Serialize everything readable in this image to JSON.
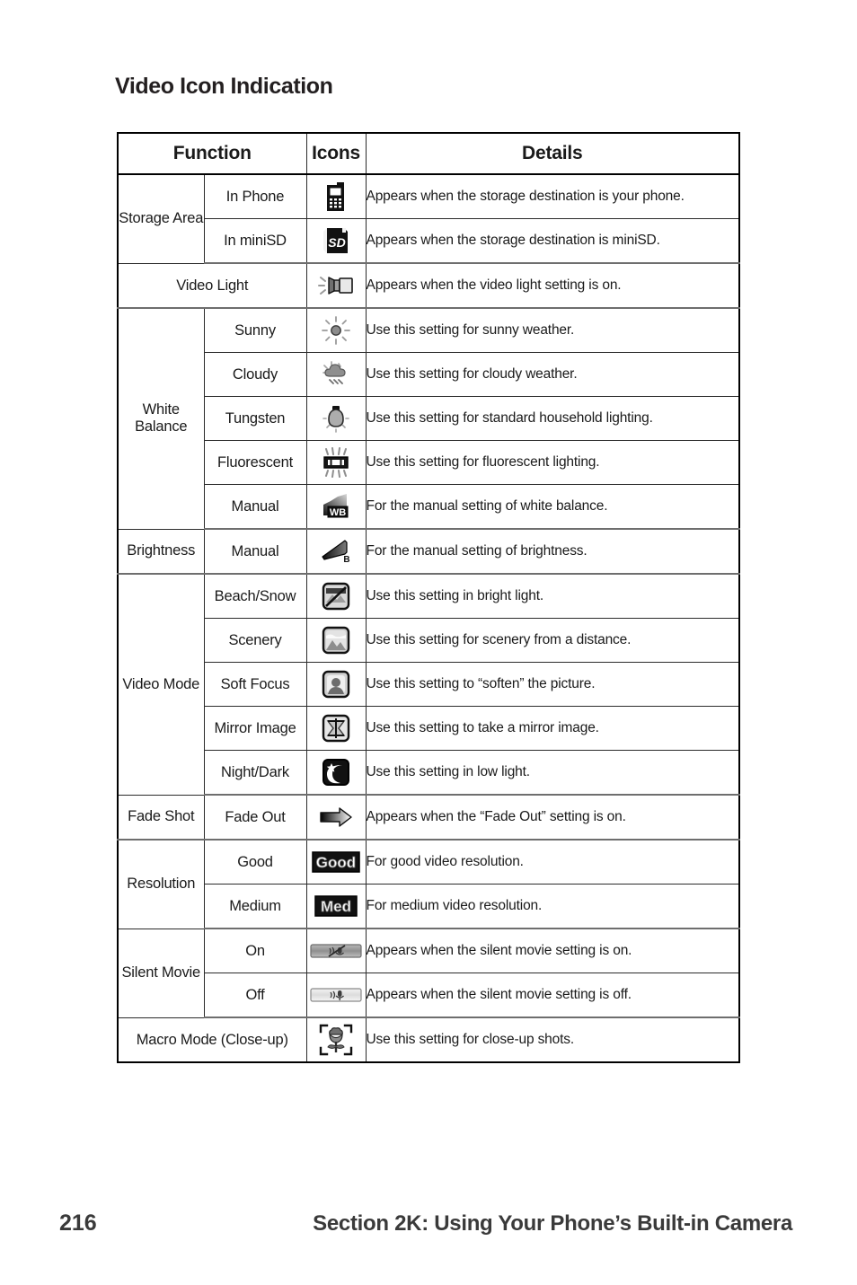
{
  "page": {
    "title": "Video Icon Indication",
    "footer_page_number": "216",
    "footer_section": "Section 2K: Using Your Phone’s Built-in Camera"
  },
  "table": {
    "headers": {
      "function": "Function",
      "icons": "Icons",
      "details": "Details"
    },
    "groups": [
      {
        "function": "Storage Area",
        "rows": [
          {
            "sub": "In Phone",
            "icon": "phone-icon",
            "detail": "Appears when the storage destination is your phone."
          },
          {
            "sub": "In miniSD",
            "icon": "minisd-card-icon",
            "detail": "Appears when the storage destination is miniSD."
          }
        ]
      },
      {
        "function": "Video Light",
        "full_span": true,
        "rows": [
          {
            "sub": "",
            "icon": "flashlight-icon",
            "detail": "Appears when the video light setting is on."
          }
        ]
      },
      {
        "function": "White Balance",
        "rows": [
          {
            "sub": "Sunny",
            "icon": "sun-icon",
            "detail": "Use this setting for sunny weather."
          },
          {
            "sub": "Cloudy",
            "icon": "cloud-sun-icon",
            "detail": "Use this setting for cloudy weather."
          },
          {
            "sub": "Tungsten",
            "icon": "lightbulb-icon",
            "detail": "Use this setting for standard household lighting."
          },
          {
            "sub": "Fluorescent",
            "icon": "fluorescent-tube-icon",
            "detail": "Use this setting for fluorescent lighting."
          },
          {
            "sub": "Manual",
            "icon": "wb-manual-icon",
            "detail": "For the manual setting of white balance."
          }
        ]
      },
      {
        "function": "Brightness",
        "rows": [
          {
            "sub": "Manual",
            "icon": "brightness-manual-icon",
            "detail": "For the manual setting of brightness."
          }
        ]
      },
      {
        "function": "Video Mode",
        "rows": [
          {
            "sub": "Beach/Snow",
            "icon": "beach-snow-icon",
            "detail": "Use this setting in bright light."
          },
          {
            "sub": "Scenery",
            "icon": "scenery-icon",
            "detail": "Use this setting for scenery from a distance."
          },
          {
            "sub": "Soft Focus",
            "icon": "soft-focus-icon",
            "detail": "Use this setting to “soften” the picture."
          },
          {
            "sub": "Mirror Image",
            "icon": "mirror-image-icon",
            "detail": "Use this setting to take a mirror image."
          },
          {
            "sub": "Night/Dark",
            "icon": "night-dark-icon",
            "detail": "Use this setting in low light."
          }
        ]
      },
      {
        "function": "Fade Shot",
        "rows": [
          {
            "sub": "Fade Out",
            "icon": "fade-out-arrow-icon",
            "detail": "Appears when the “Fade Out” setting is on."
          }
        ]
      },
      {
        "function": "Resolution",
        "rows": [
          {
            "sub": "Good",
            "icon": "resolution-good-icon",
            "icon_label": "Good",
            "detail": "For good video resolution."
          },
          {
            "sub": "Medium",
            "icon": "resolution-med-icon",
            "icon_label": "Med",
            "detail": "For medium video resolution."
          }
        ]
      },
      {
        "function": "Silent Movie",
        "rows": [
          {
            "sub": "On",
            "icon": "mic-muted-icon",
            "detail": "Appears when the silent movie setting is on."
          },
          {
            "sub": "Off",
            "icon": "mic-on-icon",
            "detail": "Appears when the silent movie setting is off."
          }
        ]
      },
      {
        "function": "Macro Mode (Close-up)",
        "full_span": true,
        "rows": [
          {
            "sub": "",
            "icon": "macro-flower-icon",
            "detail": "Use this setting for close-up shots."
          }
        ]
      }
    ]
  },
  "colors": {
    "text": "#1a1a1a",
    "rule": "#2b2b2b",
    "heavy_rule": "#000000",
    "group_rule": "#6e6e6e",
    "footer_text": "#3a3a3a"
  }
}
